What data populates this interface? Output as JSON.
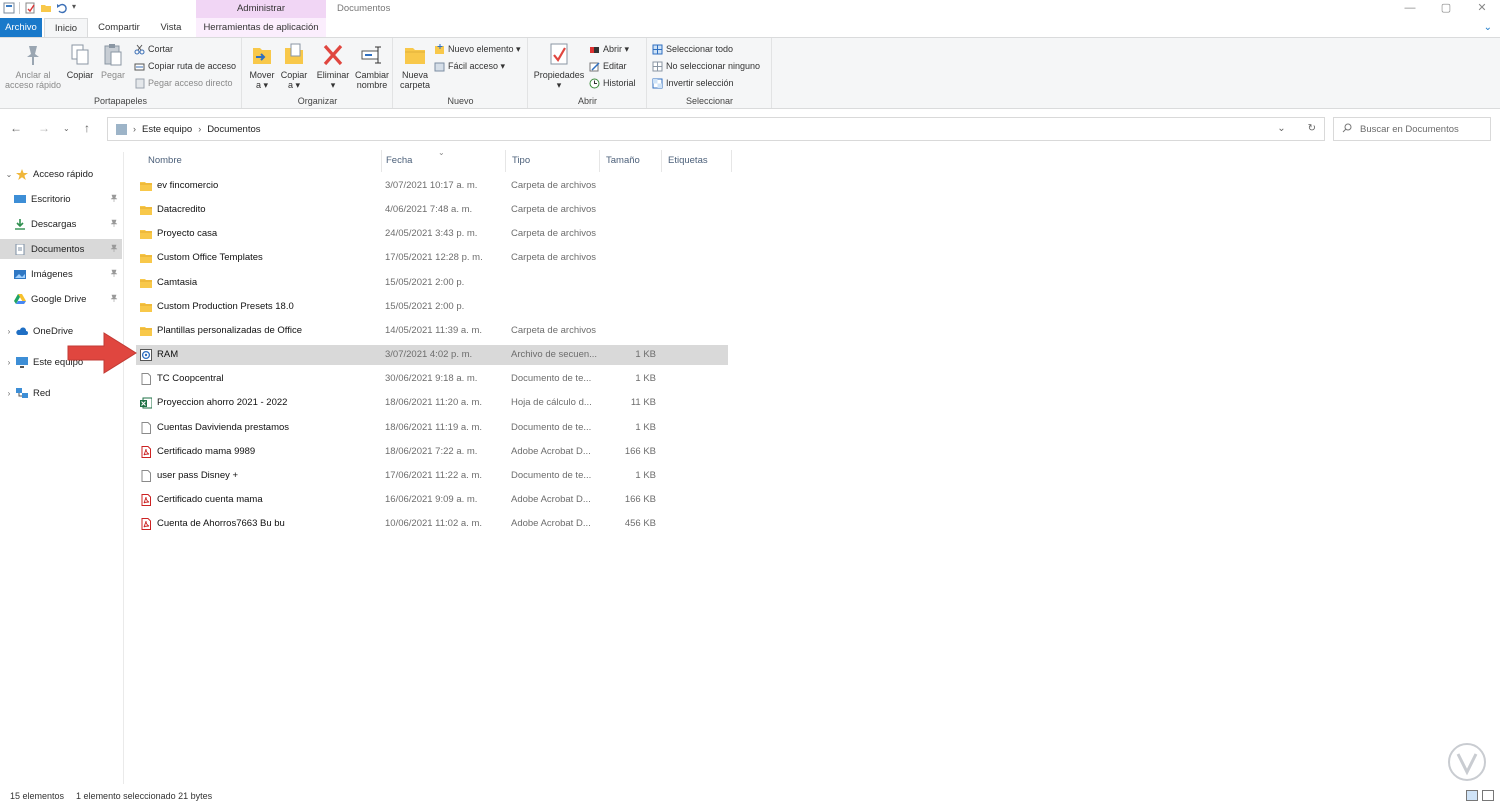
{
  "window": {
    "title": "Documentos",
    "context_group": "Administrar",
    "controls": [
      "—",
      "▢",
      "✕"
    ]
  },
  "tabs": {
    "archivo": "Archivo",
    "inicio": "Inicio",
    "compartir": "Compartir",
    "vista": "Vista",
    "herramientas": "Herramientas de aplicación"
  },
  "ribbon": {
    "portapapeles": {
      "label": "Portapapeles",
      "anclar": "Anclar al acceso rápido",
      "anclar_l1": "Anclar al",
      "anclar_l2": "acceso rápido",
      "copiar": "Copiar",
      "pegar": "Pegar",
      "cortar": "Cortar",
      "copiar_ruta": "Copiar ruta de acceso",
      "pegar_acceso": "Pegar acceso directo"
    },
    "organizar": {
      "label": "Organizar",
      "mover_l1": "Mover",
      "mover_l2": "a ▾",
      "copiar_l1": "Copiar",
      "copiar_l2": "a ▾",
      "eliminar": "Eliminar",
      "eliminar_l2": "▾",
      "cambiar_l1": "Cambiar",
      "cambiar_l2": "nombre"
    },
    "nuevo": {
      "label": "Nuevo",
      "carpeta_l1": "Nueva",
      "carpeta_l2": "carpeta",
      "nuevo_elemento": "Nuevo elemento ▾",
      "facil_acceso": "Fácil acceso ▾"
    },
    "abrir": {
      "label": "Abrir",
      "propiedades": "Propiedades",
      "propiedades_l2": "▾",
      "abrir": "Abrir ▾",
      "editar": "Editar",
      "historial": "Historial"
    },
    "seleccionar": {
      "label": "Seleccionar",
      "todo": "Seleccionar todo",
      "ninguno": "No seleccionar ninguno",
      "invertir": "Invertir selección"
    }
  },
  "address": {
    "crumbs": [
      "Este equipo",
      "Documentos"
    ],
    "search_placeholder": "Buscar en Documentos"
  },
  "nav": {
    "items": [
      {
        "label": "Acceso rápido",
        "icon": "star-icon",
        "level": 0,
        "expanded": true
      },
      {
        "label": "Escritorio",
        "icon": "desktop-icon",
        "level": 1,
        "pinned": true
      },
      {
        "label": "Descargas",
        "icon": "download-icon",
        "level": 1,
        "pinned": true
      },
      {
        "label": "Documentos",
        "icon": "documents-icon",
        "level": 1,
        "pinned": true,
        "selected": true
      },
      {
        "label": "Imágenes",
        "icon": "pictures-icon",
        "level": 1,
        "pinned": true
      },
      {
        "label": "Google Drive",
        "icon": "google-drive-icon",
        "level": 1,
        "pinned": true
      },
      {
        "label": "OneDrive",
        "icon": "onedrive-icon",
        "level": 0
      },
      {
        "label": "Este equipo",
        "icon": "computer-icon",
        "level": 0
      },
      {
        "label": "Red",
        "icon": "network-icon",
        "level": 0
      }
    ]
  },
  "columns": {
    "nombre": "Nombre",
    "fecha": "Fecha",
    "tipo": "Tipo",
    "tamano": "Tamaño",
    "etiquetas": "Etiquetas"
  },
  "files": [
    {
      "name": "ev fincomercio",
      "date": "3/07/2021 10:17 a. m.",
      "type": "Carpeta de archivos",
      "size": "",
      "icon": "folder-icon"
    },
    {
      "name": "Datacredito",
      "date": "4/06/2021 7:48 a. m.",
      "type": "Carpeta de archivos",
      "size": "",
      "icon": "folder-icon"
    },
    {
      "name": "Proyecto casa",
      "date": "24/05/2021 3:43 p. m.",
      "type": "Carpeta de archivos",
      "size": "",
      "icon": "folder-icon"
    },
    {
      "name": "Custom Office Templates",
      "date": "17/05/2021 12:28 p. m.",
      "type": "Carpeta de archivos",
      "size": "",
      "icon": "folder-icon"
    },
    {
      "name": "Camtasia",
      "date": "15/05/2021 2:00 p.",
      "type": "",
      "size": "",
      "icon": "folder-icon"
    },
    {
      "name": "Custom Production Presets 18.0",
      "date": "15/05/2021 2:00 p.",
      "type": "",
      "size": "",
      "icon": "folder-icon"
    },
    {
      "name": "Plantillas personalizadas de Office",
      "date": "14/05/2021 11:39 a. m.",
      "type": "Carpeta de archivos",
      "size": "",
      "icon": "folder-icon"
    },
    {
      "name": "RAM",
      "date": "3/07/2021 4:02 p. m.",
      "type": "Archivo de secuen...",
      "size": "1 KB",
      "icon": "script-file-icon",
      "selected": true
    },
    {
      "name": "TC Coopcentral",
      "date": "30/06/2021 9:18 a. m.",
      "type": "Documento de te...",
      "size": "1 KB",
      "icon": "text-file-icon"
    },
    {
      "name": "Proyeccion ahorro 2021 - 2022",
      "date": "18/06/2021 11:20 a. m.",
      "type": "Hoja de cálculo d...",
      "size": "11 KB",
      "icon": "excel-file-icon"
    },
    {
      "name": "Cuentas Davivienda prestamos",
      "date": "18/06/2021 11:19 a. m.",
      "type": "Documento de te...",
      "size": "1 KB",
      "icon": "text-file-icon"
    },
    {
      "name": "Certificado mama 9989",
      "date": "18/06/2021 7:22 a. m.",
      "type": "Adobe Acrobat D...",
      "size": "166 KB",
      "icon": "pdf-file-icon"
    },
    {
      "name": "user pass Disney +",
      "date": "17/06/2021 11:22 a. m.",
      "type": "Documento de te...",
      "size": "1 KB",
      "icon": "text-file-icon"
    },
    {
      "name": "Certificado cuenta mama",
      "date": "16/06/2021 9:09 a. m.",
      "type": "Adobe Acrobat D...",
      "size": "166 KB",
      "icon": "pdf-file-icon"
    },
    {
      "name": "Cuenta de Ahorros7663 Bu bu",
      "date": "10/06/2021 11:02 a. m.",
      "type": "Adobe Acrobat D...",
      "size": "456 KB",
      "icon": "pdf-file-icon"
    }
  ],
  "status": {
    "count": "15 elementos",
    "selection": "1 elemento seleccionado  21 bytes"
  },
  "colors": {
    "accent": "#1979ca",
    "selection": "#d9d9d9",
    "folder": "#f8c84a",
    "arrow": "#e0463f",
    "context_tab": "#f1d6f5"
  }
}
